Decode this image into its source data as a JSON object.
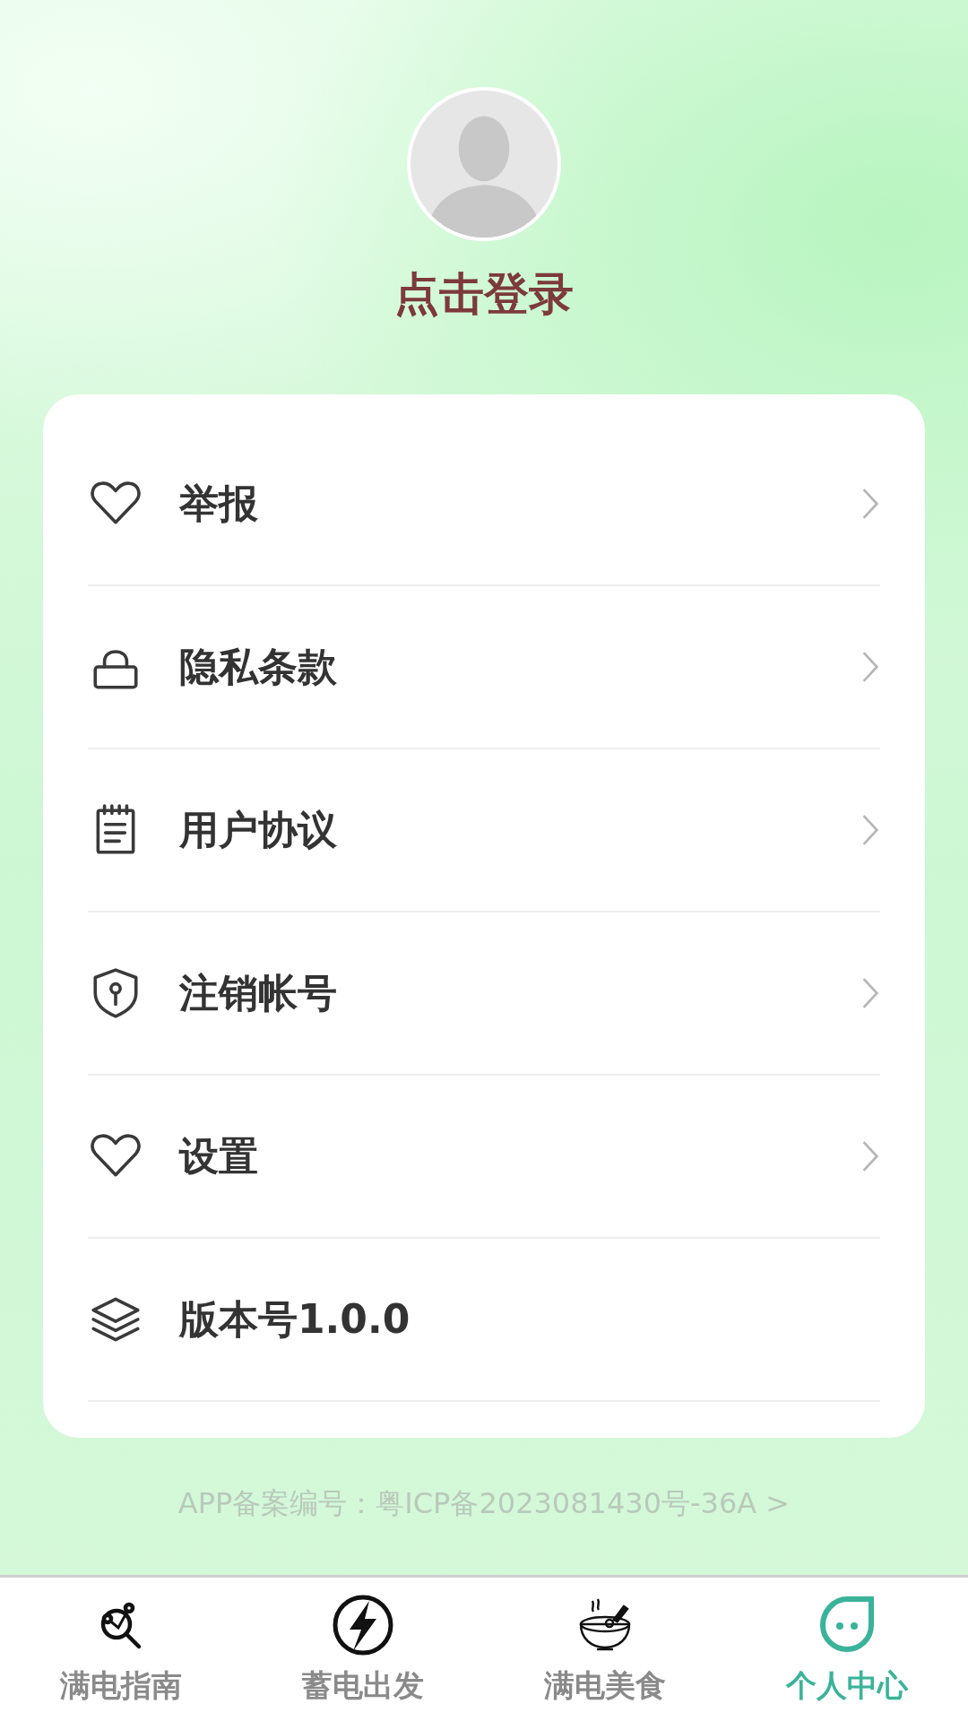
{
  "profile": {
    "login_label": "点击登录"
  },
  "menu": [
    {
      "kind": "heart",
      "label": "举报",
      "arrow": true
    },
    {
      "kind": "lock",
      "label": "隐私条款",
      "arrow": true
    },
    {
      "kind": "notepad",
      "label": "用户协议",
      "arrow": true
    },
    {
      "kind": "shield",
      "label": "注销帐号",
      "arrow": true
    },
    {
      "kind": "heart",
      "label": "设置",
      "arrow": true
    },
    {
      "kind": "layers",
      "label": "版本号1.0.0",
      "arrow": false
    }
  ],
  "icp_link": "APP备案编号：粤ICP备2023081430号-36A >",
  "tab_bar": [
    {
      "kind": "guide",
      "label": "满电指南",
      "selected": false
    },
    {
      "kind": "bolt",
      "label": "蓄电出发",
      "selected": false
    },
    {
      "kind": "bowl",
      "label": "满电美食",
      "selected": false
    },
    {
      "kind": "face",
      "label": "个人中心",
      "selected": true
    }
  ]
}
